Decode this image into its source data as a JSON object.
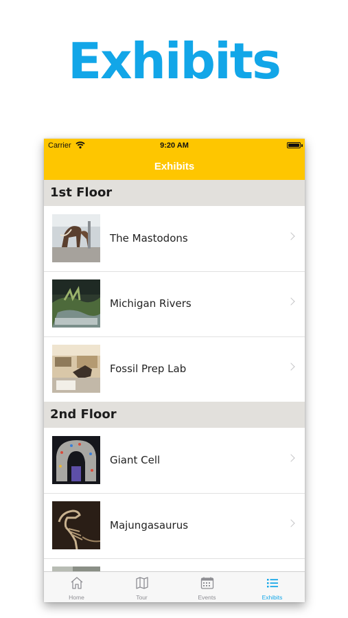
{
  "hero": {
    "title": "Exhibits"
  },
  "status_bar": {
    "carrier": "Carrier",
    "time": "9:20 AM"
  },
  "nav": {
    "title": "Exhibits"
  },
  "sections": [
    {
      "title": "1st Floor",
      "items": [
        {
          "label": "The Mastodons"
        },
        {
          "label": "Michigan Rivers"
        },
        {
          "label": "Fossil Prep Lab"
        }
      ]
    },
    {
      "title": "2nd Floor",
      "items": [
        {
          "label": "Giant Cell"
        },
        {
          "label": "Majungasaurus"
        }
      ]
    }
  ],
  "tabs": [
    {
      "label": "Home",
      "icon": "home-icon"
    },
    {
      "label": "Tour",
      "icon": "map-icon"
    },
    {
      "label": "Events",
      "icon": "calendar-icon"
    },
    {
      "label": "Exhibits",
      "icon": "list-icon",
      "active": true
    }
  ],
  "colors": {
    "brand_yellow": "#fec600",
    "accent_blue": "#12a6e8",
    "section_gray": "#e2e0dc"
  }
}
